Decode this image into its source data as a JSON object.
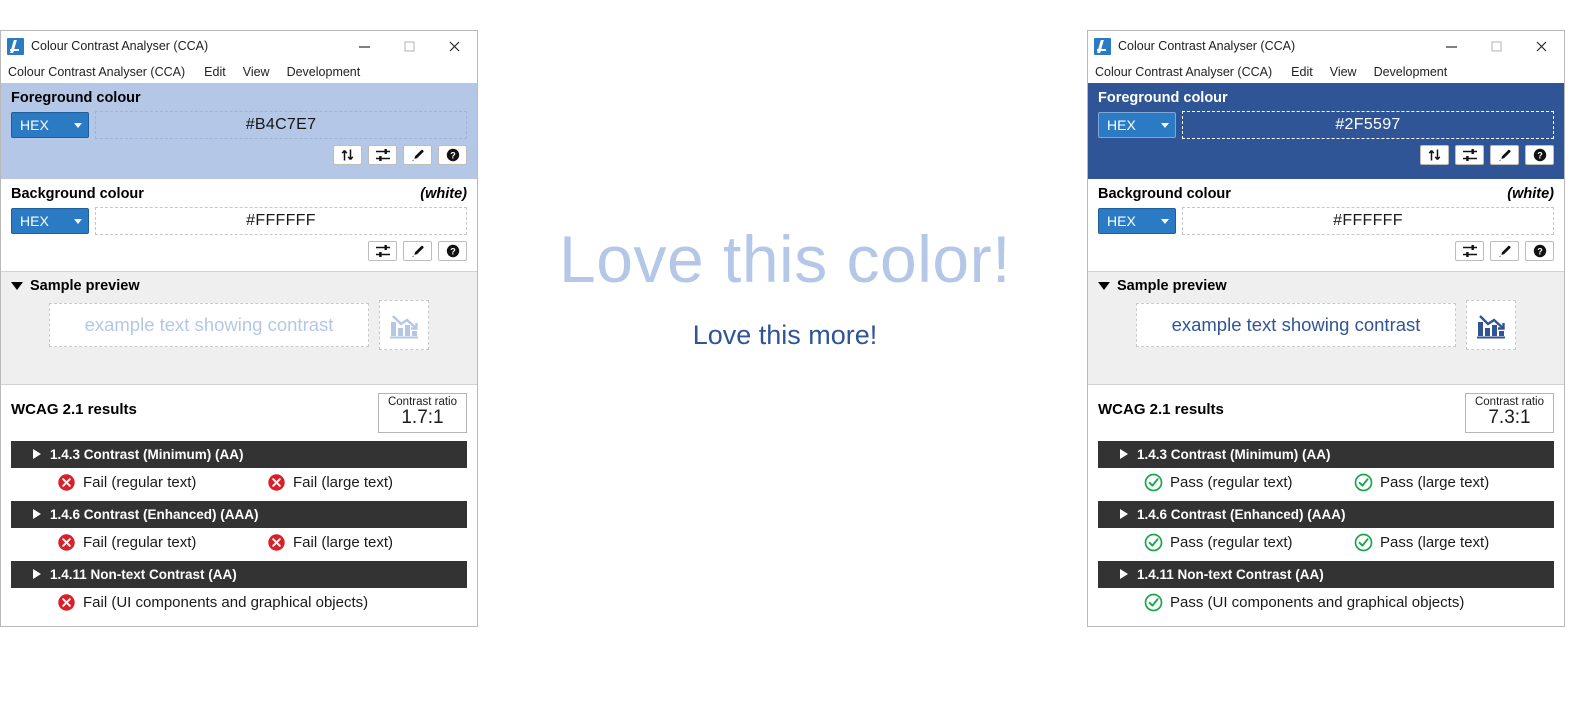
{
  "windows": [
    {
      "id": "left",
      "titlebar": {
        "app_icon": "cca-logo-icon",
        "title": "Colour Contrast Analyser (CCA)",
        "minimize": "minimize-icon",
        "maximize": "maximize-icon",
        "close": "close-icon"
      },
      "menubar": [
        "Colour Contrast Analyser (CCA)",
        "Edit",
        "View",
        "Development"
      ],
      "foreground": {
        "label": "Foreground colour",
        "note": "",
        "format": "HEX",
        "value": "#B4C7E7",
        "placeholder": "#B4C7E7",
        "panel_color": "#B4C7E7",
        "buttons": [
          "swap-colours-icon",
          "sliders-icon",
          "eyedropper-icon",
          "help-icon"
        ]
      },
      "background": {
        "label": "Background colour",
        "note": "(white)",
        "format": "HEX",
        "value": "#FFFFFF",
        "placeholder": "#FFFFFF",
        "panel_color": "#FFFFFF",
        "buttons": [
          "sliders-icon",
          "eyedropper-icon",
          "help-icon"
        ]
      },
      "sample": {
        "title": "Sample preview",
        "text": "example text showing contrast",
        "icon": "bar-chart-down-trend-icon",
        "sample_color": "#B4C7E7"
      },
      "wcag": {
        "title": "WCAG 2.1 results",
        "ratio_label": "Contrast ratio",
        "ratio_value": "1.7:1",
        "criteria": [
          {
            "name": "1.4.3 Contrast (Minimum) (AA)",
            "results": [
              {
                "status": "fail",
                "label": "Fail (regular text)"
              },
              {
                "status": "fail",
                "label": "Fail (large text)"
              }
            ]
          },
          {
            "name": "1.4.6 Contrast (Enhanced) (AAA)",
            "results": [
              {
                "status": "fail",
                "label": "Fail (regular text)"
              },
              {
                "status": "fail",
                "label": "Fail (large text)"
              }
            ]
          },
          {
            "name": "1.4.11 Non-text Contrast (AA)",
            "results": [
              {
                "status": "fail",
                "label": "Fail (UI components and graphical objects)"
              }
            ]
          }
        ]
      }
    },
    {
      "id": "right",
      "titlebar": {
        "app_icon": "cca-logo-icon",
        "title": "Colour Contrast Analyser (CCA)",
        "minimize": "minimize-icon",
        "maximize": "maximize-icon",
        "close": "close-icon"
      },
      "menubar": [
        "Colour Contrast Analyser (CCA)",
        "Edit",
        "View",
        "Development"
      ],
      "foreground": {
        "label": "Foreground colour",
        "note": "",
        "format": "HEX",
        "value": "#2F5597",
        "placeholder": "#2F5597",
        "panel_color": "#2F5597",
        "buttons": [
          "swap-colours-icon",
          "sliders-icon",
          "eyedropper-icon",
          "help-icon"
        ]
      },
      "background": {
        "label": "Background colour",
        "note": "(white)",
        "format": "HEX",
        "value": "#FFFFFF",
        "placeholder": "#FFFFFF",
        "panel_color": "#FFFFFF",
        "buttons": [
          "sliders-icon",
          "eyedropper-icon",
          "help-icon"
        ]
      },
      "sample": {
        "title": "Sample preview",
        "text": "example text showing contrast",
        "icon": "bar-chart-down-trend-icon",
        "sample_color": "#2F5597"
      },
      "wcag": {
        "title": "WCAG 2.1 results",
        "ratio_label": "Contrast ratio",
        "ratio_value": "7.3:1",
        "criteria": [
          {
            "name": "1.4.3 Contrast (Minimum) (AA)",
            "results": [
              {
                "status": "pass",
                "label": "Pass (regular text)"
              },
              {
                "status": "pass",
                "label": "Pass (large text)"
              }
            ]
          },
          {
            "name": "1.4.6 Contrast (Enhanced) (AAA)",
            "results": [
              {
                "status": "pass",
                "label": "Pass (regular text)"
              },
              {
                "status": "pass",
                "label": "Pass (large text)"
              }
            ]
          },
          {
            "name": "1.4.11 Non-text Contrast (AA)",
            "results": [
              {
                "status": "pass",
                "label": "Pass (UI components and graphical objects)"
              }
            ]
          }
        ]
      }
    }
  ],
  "centre": {
    "headline": "Love this color!",
    "subline": "Love this more!",
    "headline_color": "#B4C7E7",
    "subline_color": "#2F5597"
  },
  "colors": {
    "light_blue": "#B4C7E7",
    "dark_blue": "#2F5597",
    "accent_blue": "#2A7BC4",
    "fail_red": "#D81F2A",
    "pass_green": "#17A84B",
    "criterion_bar": "#333333"
  }
}
